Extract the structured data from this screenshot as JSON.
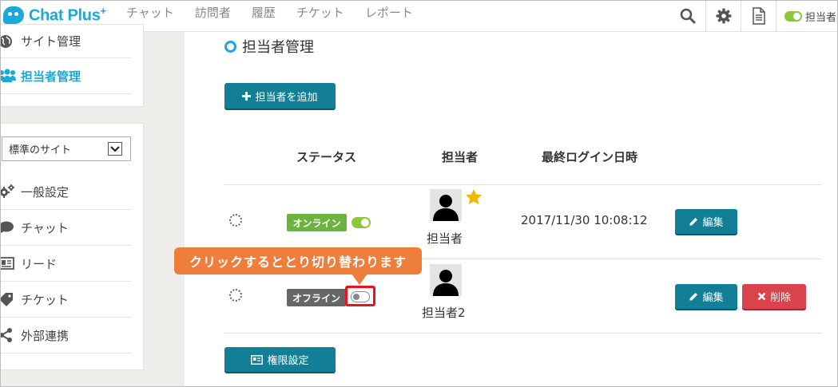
{
  "app": {
    "logo_text": "Chat Plus",
    "logo_plus": "+"
  },
  "topnav": {
    "items": [
      "チャット",
      "訪問者",
      "履歴",
      "チケット",
      "レポート"
    ],
    "status_label": "担当者"
  },
  "sidebar": {
    "top_items": [
      {
        "label": "サイト管理",
        "icon": "globe-icon"
      },
      {
        "label": "担当者管理",
        "icon": "users-icon",
        "active": true
      }
    ],
    "site_select_value": "標準のサイト",
    "items": [
      {
        "label": "一般設定",
        "icon": "gears-icon"
      },
      {
        "label": "チャット",
        "icon": "speech-bubble-icon"
      },
      {
        "label": "リード",
        "icon": "id-card-icon"
      },
      {
        "label": "チケット",
        "icon": "ticket-icon"
      },
      {
        "label": "外部連携",
        "icon": "share-icon"
      }
    ]
  },
  "main": {
    "title": "担当者管理",
    "add_button": "担当者を追加",
    "columns": {
      "status": "ステータス",
      "agent": "担当者",
      "last_login": "最終ログイン日時"
    },
    "rows": [
      {
        "status": "オンライン",
        "online": true,
        "name": "担当者",
        "is_owner": true,
        "last_login": "2017/11/30 10:08:12",
        "edit": "編集"
      },
      {
        "status": "オフライン",
        "online": false,
        "name": "担当者2",
        "is_owner": false,
        "last_login": "",
        "edit": "編集",
        "delete": "削除"
      }
    ],
    "permissions_button": "権限設定"
  },
  "annotation": {
    "callout": "クリックするととり切り替わります"
  },
  "colors": {
    "accent": "#1aa9d8",
    "button": "#137f96",
    "online": "#6cb33f",
    "offline": "#666666",
    "danger": "#d9434b",
    "callout": "#ef7d3c",
    "highlight": "#e8141b"
  }
}
